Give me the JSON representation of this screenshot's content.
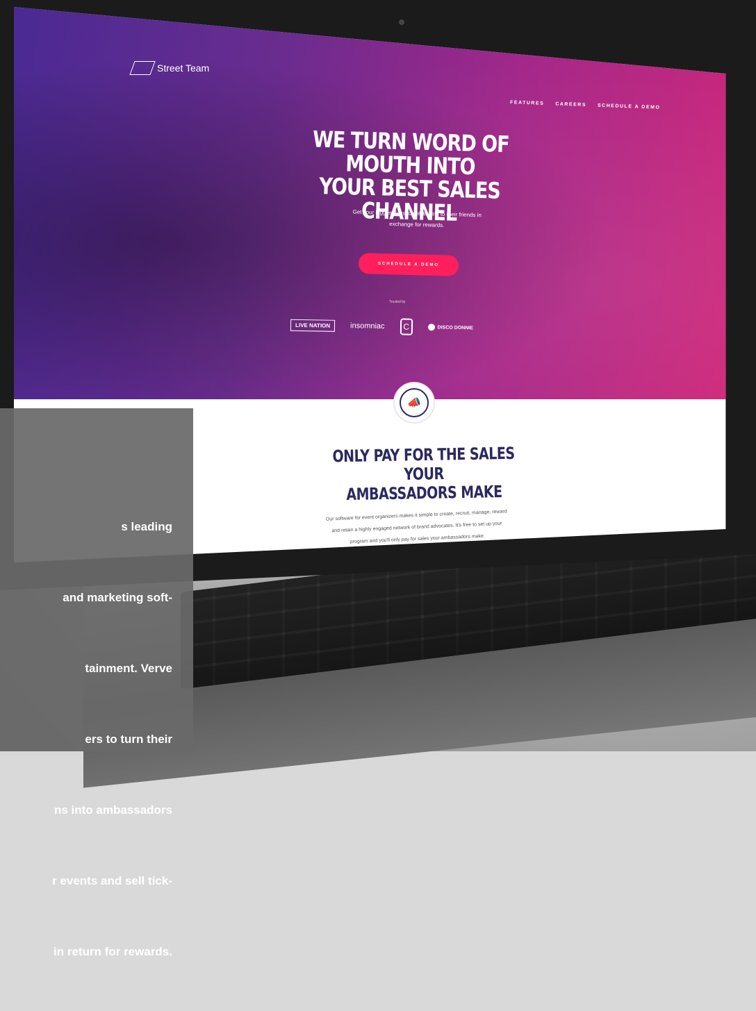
{
  "site": {
    "brand": "Street Team",
    "nav": [
      "FEATURES",
      "CAREERS",
      "SCHEDULE A DEMO"
    ],
    "hero": {
      "headline_lines": [
        "WE TURN WORD OF MOUTH INTO",
        "YOUR BEST SALES CHANNEL"
      ],
      "subhead_lines": [
        "Get your biggest fans to sell tickets to their friends in",
        "exchange for rewards."
      ],
      "cta": "SCHEDULE A DEMO",
      "trusted_label": "Trusted by",
      "partner_logos": [
        "LIVE NATION",
        "insomniac",
        "C",
        "DISCO DONNIE"
      ]
    },
    "section": {
      "icon": "megaphone-icon",
      "title_lines": [
        "ONLY PAY FOR THE SALES YOUR",
        "AMBASSADORS MAKE"
      ],
      "body_lines": [
        "Our software for event organizers makes it simple to create, recruit, manage, reward",
        "and retain a highly engaged network of brand advocates. It's free to set up your",
        "program and you'll only pay for sales your ambassadors make."
      ]
    }
  },
  "overlay": {
    "lines": [
      "s leading",
      "and marketing soft-",
      "tainment. Verve",
      "ers to turn their",
      "ns into ambassadors",
      "r events and sell tick-",
      "in return for rewards."
    ]
  },
  "colors": {
    "hero_start": "#4a2a93",
    "hero_end": "#d02678",
    "cta": "#ff1f5c",
    "title": "#2b2960",
    "overlay": "#696969"
  }
}
